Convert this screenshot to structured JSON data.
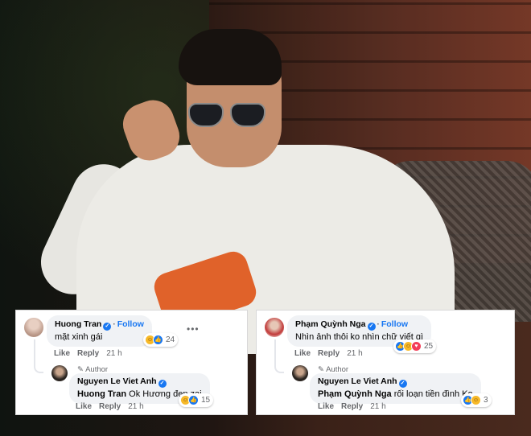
{
  "comments": [
    {
      "name": "Huong Tran",
      "follow_label": "Follow",
      "text": "mặt xinh gái",
      "like_label": "Like",
      "reply_label": "Reply",
      "time": "21 h",
      "reaction_count": "24",
      "reply": {
        "author_badge": "Author",
        "name": "Nguyen Le Viet Anh",
        "tagged": "Huong Tran",
        "text": " Ok Hương đẹp zai",
        "like_label": "Like",
        "reply_label": "Reply",
        "time": "21 h",
        "reaction_count": "15"
      }
    },
    {
      "name": "Phạm Quỳnh Nga",
      "follow_label": "Follow",
      "text": "Nhìn ảnh thôi ko nhìn chữ viết gì",
      "like_label": "Like",
      "reply_label": "Reply",
      "time": "21 h",
      "reaction_count": "25",
      "reply": {
        "author_badge": "Author",
        "name": "Nguyen Le Viet Anh",
        "tagged": "Phạm Quỳnh Nga",
        "text": " rối loạn tiền đình Ko",
        "like_label": "Like",
        "reply_label": "Reply",
        "time": "21 h",
        "reaction_count": "3"
      }
    }
  ],
  "icons": {
    "verified": "verified-badge-icon",
    "more": "more-options-icon",
    "author": "pencil-icon",
    "reactions": [
      "like-icon",
      "haha-icon",
      "love-icon"
    ]
  },
  "colors": {
    "link": "#1877f2",
    "bubble": "#f0f2f5",
    "meta": "#65676b",
    "cushion": "#e0622a"
  }
}
